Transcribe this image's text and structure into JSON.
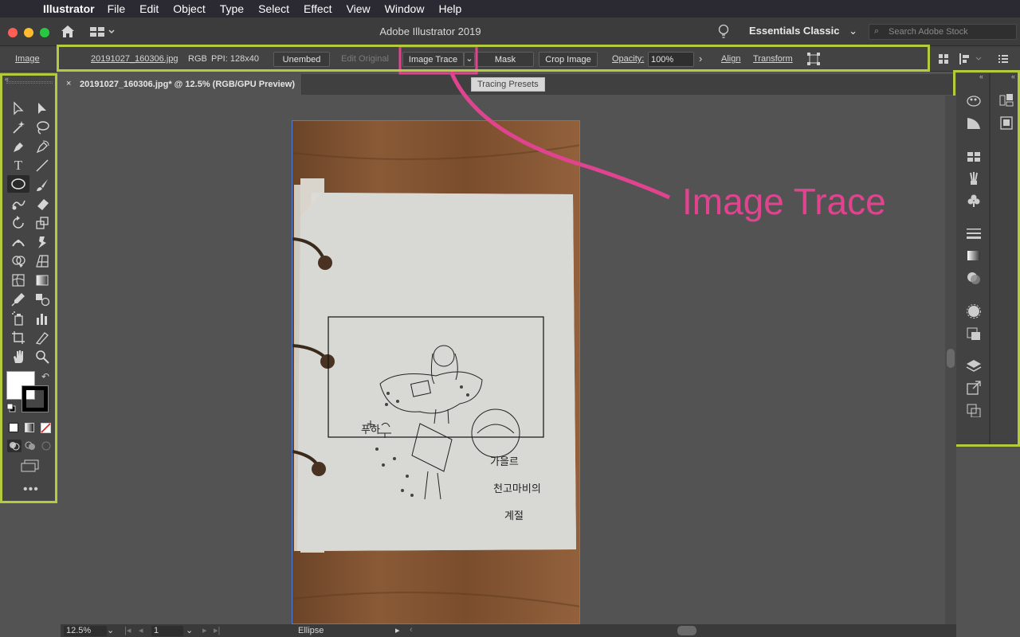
{
  "menubar": {
    "app": "Illustrator",
    "items": [
      "File",
      "Edit",
      "Object",
      "Type",
      "Select",
      "Effect",
      "View",
      "Window",
      "Help"
    ]
  },
  "titlebar": {
    "title": "Adobe Illustrator 2019",
    "workspace": "Essentials Classic",
    "stock_placeholder": "Search Adobe Stock"
  },
  "controlbar": {
    "label": "Image",
    "filename": "20191027_160306.jpg",
    "mode": "RGB",
    "ppi": "PPI: 128x40",
    "unembed": "Unembed",
    "edit_original": "Edit Original",
    "image_trace": "Image Trace",
    "mask": "Mask",
    "crop": "Crop Image",
    "opacity_label": "Opacity:",
    "opacity_value": "100%",
    "align": "Align",
    "transform": "Transform"
  },
  "tooltip": "Tracing Presets",
  "document": {
    "tab_title": "20191027_160306.jpg* @ 12.5% (RGB/GPU Preview)"
  },
  "statusbar": {
    "zoom": "12.5%",
    "page": "1",
    "tool": "Ellipse"
  },
  "annotation": {
    "text": "Image Trace",
    "color": "#e0448f"
  },
  "highlight_color": "#b5cb3d",
  "sketch_text": {
    "t1": "푸하",
    "t2": "가을르",
    "t3": "천고마비의",
    "t4": "계절"
  }
}
